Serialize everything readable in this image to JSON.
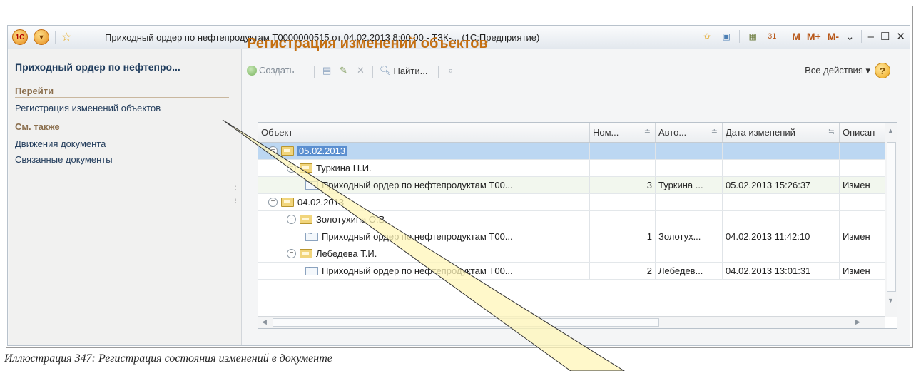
{
  "window": {
    "title": "Приходный ордер по нефтепродуктам Т0000000515 от 04.02.2013 8:00:00 - ТЗК-... (1С:Предприятие)",
    "logo_text": "1С",
    "mem_buttons": [
      "M",
      "M+",
      "M-"
    ]
  },
  "left_panel": {
    "title": "Приходный ордер по нефтепро...",
    "goto_heading": "Перейти",
    "goto_items": [
      "Регистрация изменений объектов"
    ],
    "see_also_heading": "См. также",
    "see_also_items": [
      "Движения документа",
      "Связанные документы"
    ]
  },
  "main": {
    "title": "Регистрация изменений объектов",
    "toolbar": {
      "create_label": "Создать",
      "find_label": "Найти...",
      "all_actions_label": "Все действия ▾",
      "help_label": "?"
    },
    "table": {
      "columns": [
        "Объект",
        "Ном...",
        "Авто...",
        "Дата изменений",
        "Описан"
      ],
      "rows": [
        {
          "level": 0,
          "type": "group",
          "toggle": "⊖",
          "object": "05.02.2013",
          "num": "",
          "author": "",
          "date": "",
          "desc": "",
          "selected": true
        },
        {
          "level": 1,
          "type": "group",
          "toggle": "⊖",
          "object": "Туркина Н.И.",
          "num": "",
          "author": "",
          "date": "",
          "desc": ""
        },
        {
          "level": 2,
          "type": "item",
          "object": "Приходный ордер по нефтепродуктам Т00...",
          "num": "3",
          "author": "Туркина ...",
          "date": "05.02.2013 15:26:37",
          "desc": "Измен",
          "alt": true
        },
        {
          "level": 0,
          "type": "group",
          "toggle": "⊖",
          "object": "04.02.2013",
          "num": "",
          "author": "",
          "date": "",
          "desc": ""
        },
        {
          "level": 1,
          "type": "group",
          "toggle": "⊖",
          "object": "Золотухина О.В.",
          "num": "",
          "author": "",
          "date": "",
          "desc": ""
        },
        {
          "level": 2,
          "type": "item",
          "object": "Приходный ордер по нефтепродуктам Т00...",
          "num": "1",
          "author": "Золотух...",
          "date": "04.02.2013 11:42:10",
          "desc": "Измен"
        },
        {
          "level": 1,
          "type": "group",
          "toggle": "⊖",
          "object": "Лебедева Т.И.",
          "num": "",
          "author": "",
          "date": "",
          "desc": ""
        },
        {
          "level": 2,
          "type": "item",
          "object": "Приходный ордер по нефтепродуктам Т00...",
          "num": "2",
          "author": "Лебедев...",
          "date": "04.02.2013 13:01:31",
          "desc": "Измен"
        }
      ]
    }
  },
  "caption": "Иллюстрация 347: Регистрация состояния изменений в документе",
  "colors": {
    "accent": "#c46f11",
    "link": "#233d5c",
    "selected_row": "#bcd7f2",
    "callout_fill": "#fff6b8"
  }
}
